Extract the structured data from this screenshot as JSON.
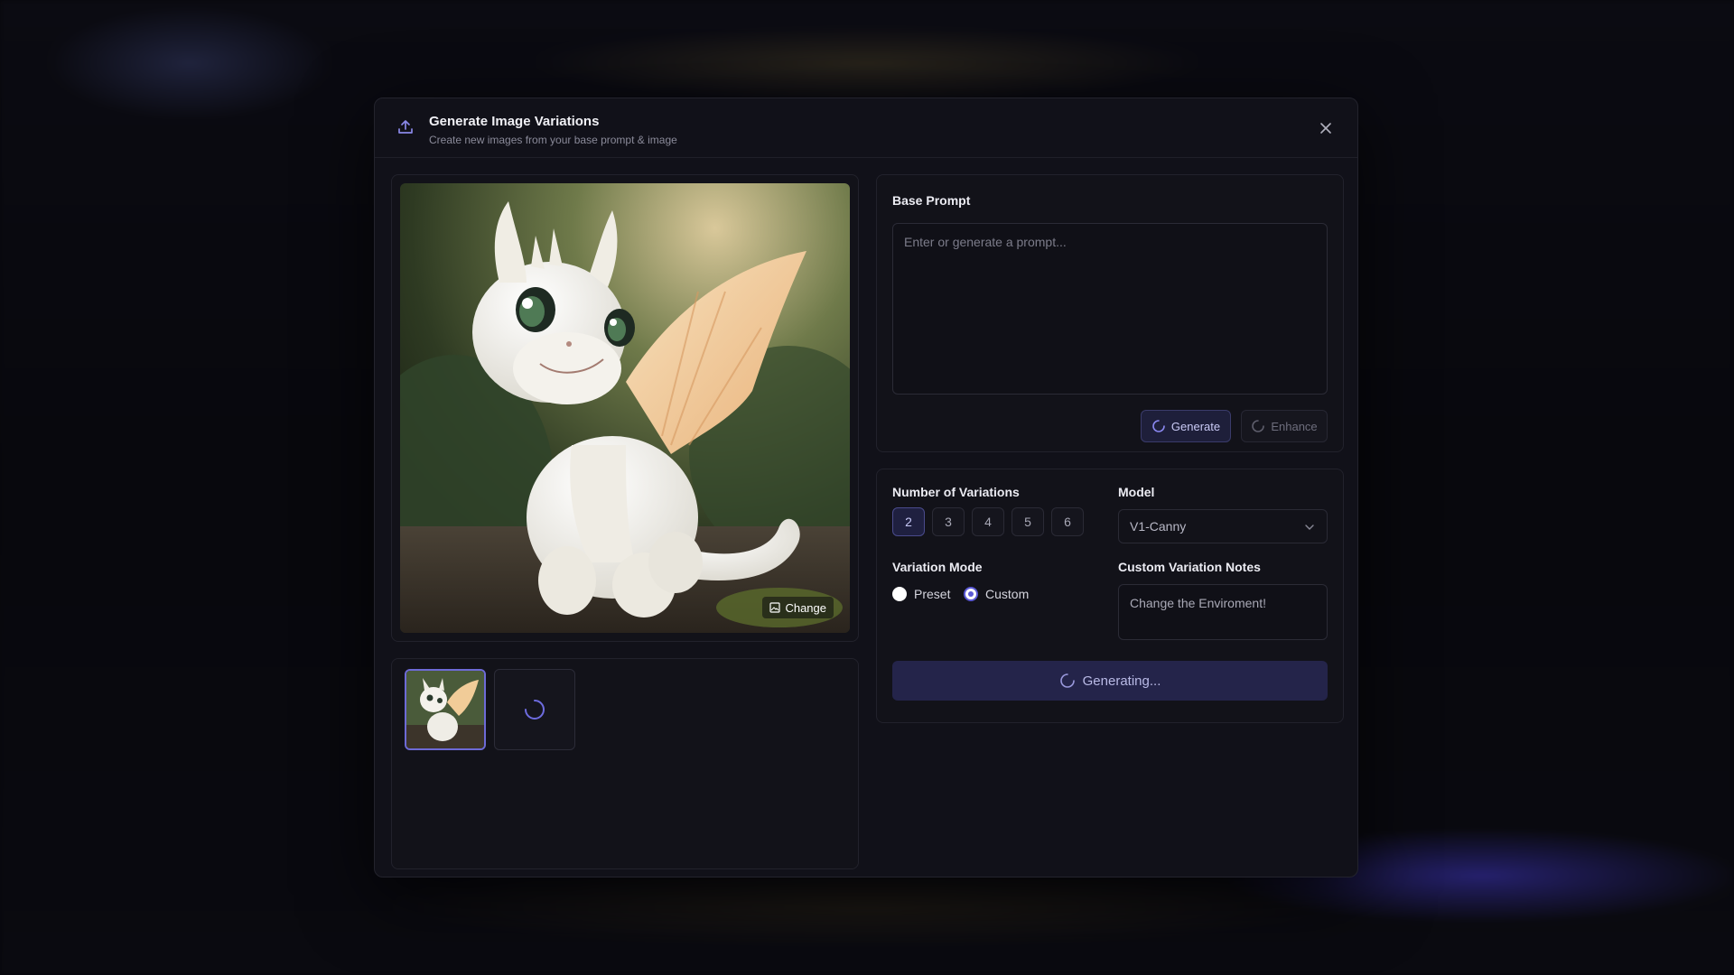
{
  "modal": {
    "title": "Generate Image Variations",
    "subtitle": "Create new images from your base prompt & image",
    "close_icon": "close-icon",
    "header_icon": "upload-icon"
  },
  "image_panel": {
    "change_label": "Change",
    "change_icon": "image-icon"
  },
  "thumbnails": {
    "items": [
      "dragon-thumbnail",
      "loading-thumbnail"
    ]
  },
  "prompt": {
    "label": "Base Prompt",
    "placeholder": "Enter or generate a prompt...",
    "value": "",
    "generate_label": "Generate",
    "enhance_label": "Enhance"
  },
  "settings": {
    "variations_label": "Number of Variations",
    "variation_options": [
      "2",
      "3",
      "4",
      "5",
      "6"
    ],
    "selected_variation": "2",
    "model_label": "Model",
    "model_value": "V1-Canny",
    "mode_label": "Variation Mode",
    "mode_options": [
      "Preset",
      "Custom"
    ],
    "selected_mode": "Custom",
    "notes_label": "Custom Variation Notes",
    "notes_value": "Change the Enviroment!",
    "generating_label": "Generating..."
  },
  "colors": {
    "accent": "#5b59d6",
    "modal_bg": "#111119",
    "panel_border": "#22222c"
  }
}
